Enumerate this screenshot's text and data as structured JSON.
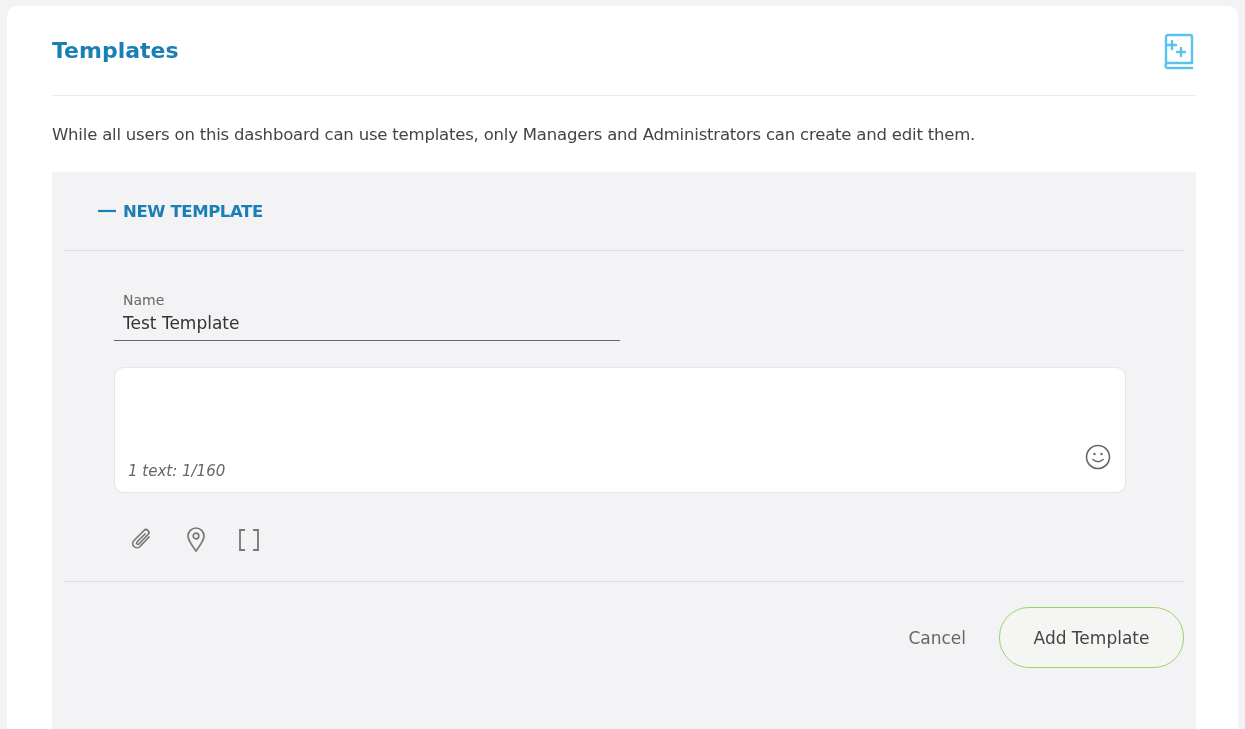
{
  "title": "Templates",
  "description": "While all users on this dashboard can use templates, only Managers and Administrators can create and edit them.",
  "new_template": {
    "label": "NEW TEMPLATE",
    "expanded": true,
    "name_field": {
      "label": "Name",
      "value": "Test Template"
    },
    "message": {
      "counter": "1 text: 1/160"
    },
    "buttons": [
      {
        "label": "Cancel",
        "kind": "text"
      },
      {
        "label": "Add Template",
        "kind": "outlined"
      }
    ]
  }
}
